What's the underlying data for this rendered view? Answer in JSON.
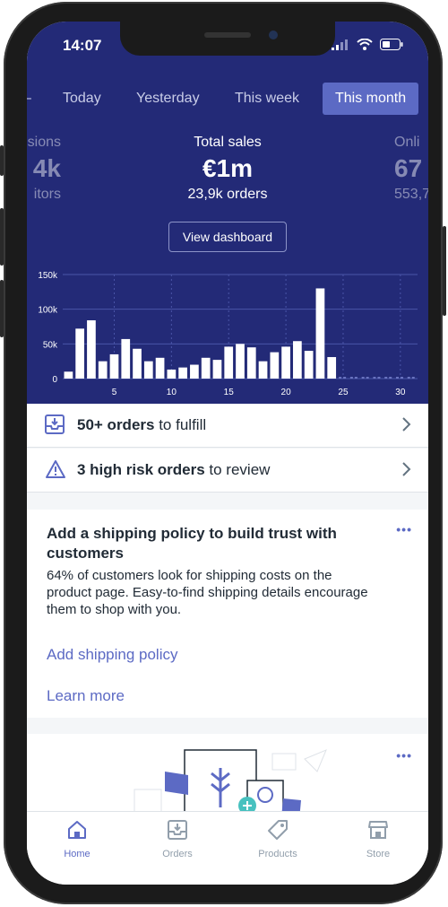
{
  "status": {
    "time": "14:07"
  },
  "tabs": [
    {
      "label": "Today",
      "active": false
    },
    {
      "label": "Yesterday",
      "active": false
    },
    {
      "label": "This week",
      "active": false
    },
    {
      "label": "This month",
      "active": true
    }
  ],
  "metrics": {
    "left": {
      "value": "4k",
      "label_top": "sions",
      "label_bottom": "itors"
    },
    "center": {
      "title": "Total sales",
      "value": "€1m",
      "sub": "23,9k orders"
    },
    "right": {
      "value": "67",
      "label_top": "Onli",
      "label_bottom": "553,7"
    }
  },
  "view_dashboard": "View dashboard",
  "chart_data": {
    "type": "bar",
    "x": [
      1,
      2,
      3,
      4,
      5,
      6,
      7,
      8,
      9,
      10,
      11,
      12,
      13,
      14,
      15,
      16,
      17,
      18,
      19,
      20,
      21,
      22,
      23,
      24,
      25,
      26,
      27,
      28,
      29,
      30,
      31
    ],
    "values": [
      10,
      72,
      84,
      25,
      35,
      57,
      43,
      25,
      30,
      13,
      16,
      20,
      30,
      27,
      46,
      50,
      45,
      25,
      38,
      46,
      54,
      40,
      130,
      31,
      0,
      0,
      0,
      0,
      0,
      0,
      0
    ],
    "xticks": [
      "5",
      "10",
      "15",
      "20",
      "25",
      "30"
    ],
    "yticks": [
      "0",
      "50k",
      "100k",
      "150k"
    ],
    "ylim": [
      0,
      150000
    ],
    "bar_color": "#ffffff",
    "grid": true
  },
  "rows": [
    {
      "bold": "50+ orders",
      "rest": " to fulfill",
      "icon": "inbox-download-icon"
    },
    {
      "bold": "3 high risk orders",
      "rest": " to review",
      "icon": "warning-triangle-icon"
    }
  ],
  "card": {
    "title": "Add a shipping policy to build trust with customers",
    "body": "64% of customers look for shipping costs on the product page. Easy-to-find shipping details encourage them to shop with you.",
    "primary_link": "Add shipping policy",
    "secondary_link": "Learn more",
    "menu": "•••"
  },
  "card2": {
    "menu": "•••"
  },
  "nav": [
    {
      "label": "Home",
      "icon": "home-icon",
      "active": true
    },
    {
      "label": "Orders",
      "icon": "orders-icon",
      "active": false
    },
    {
      "label": "Products",
      "icon": "tag-icon",
      "active": false
    },
    {
      "label": "Store",
      "icon": "store-icon",
      "active": false
    }
  ],
  "colors": {
    "hero": "#232a77",
    "accent": "#5c6ac4",
    "text": "#212b36"
  }
}
